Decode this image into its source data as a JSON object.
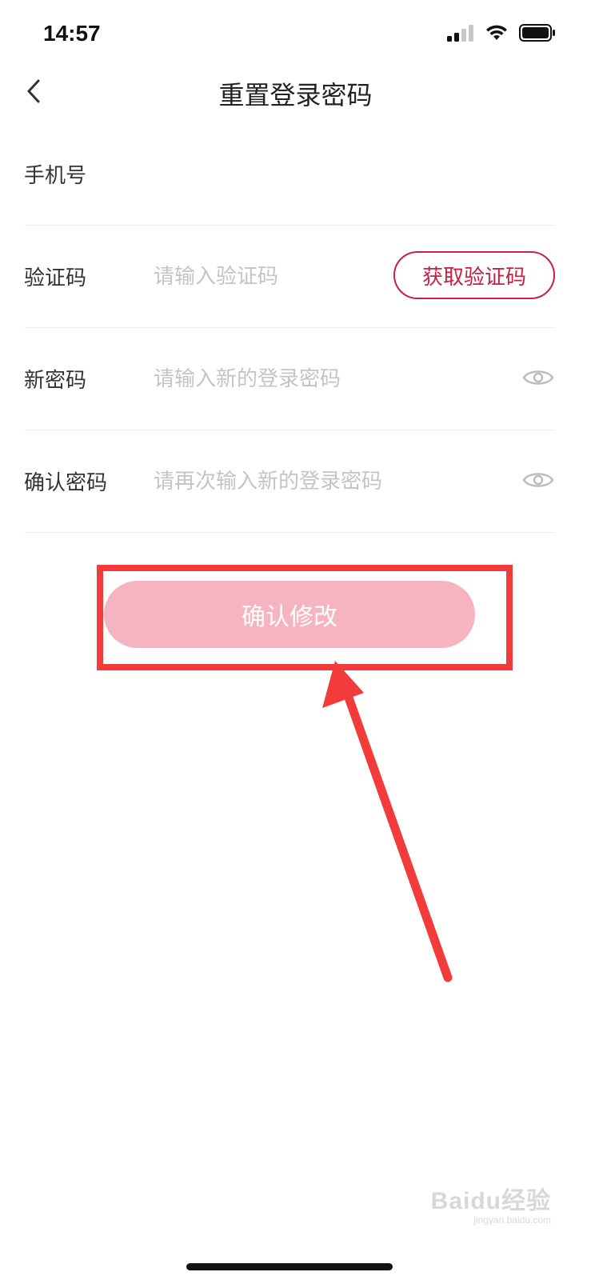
{
  "status_bar": {
    "time": "14:57",
    "icons": [
      "signal-icon",
      "wifi-icon",
      "battery-icon"
    ]
  },
  "nav": {
    "back_icon": "chevron-left-icon",
    "title": "重置登录密码"
  },
  "form": {
    "phone": {
      "label": "手机号",
      "value": ""
    },
    "code": {
      "label": "验证码",
      "placeholder": "请输入验证码",
      "button_label": "获取验证码"
    },
    "new_password": {
      "label": "新密码",
      "placeholder": "请输入新的登录密码",
      "toggle_icon": "eye-icon"
    },
    "confirm_password": {
      "label": "确认密码",
      "placeholder": "请再次输入新的登录密码",
      "toggle_icon": "eye-icon"
    }
  },
  "confirm_button": {
    "label": "确认修改"
  },
  "watermark": {
    "main": "Baidu经验",
    "sub": "jingyan.baidu.com"
  },
  "colors": {
    "accent": "#c91f43",
    "button_disabled": "#f6b4c1",
    "annotation": "#f23b3b",
    "placeholder": "#c4c4c4",
    "divider": "#eeeeee"
  }
}
